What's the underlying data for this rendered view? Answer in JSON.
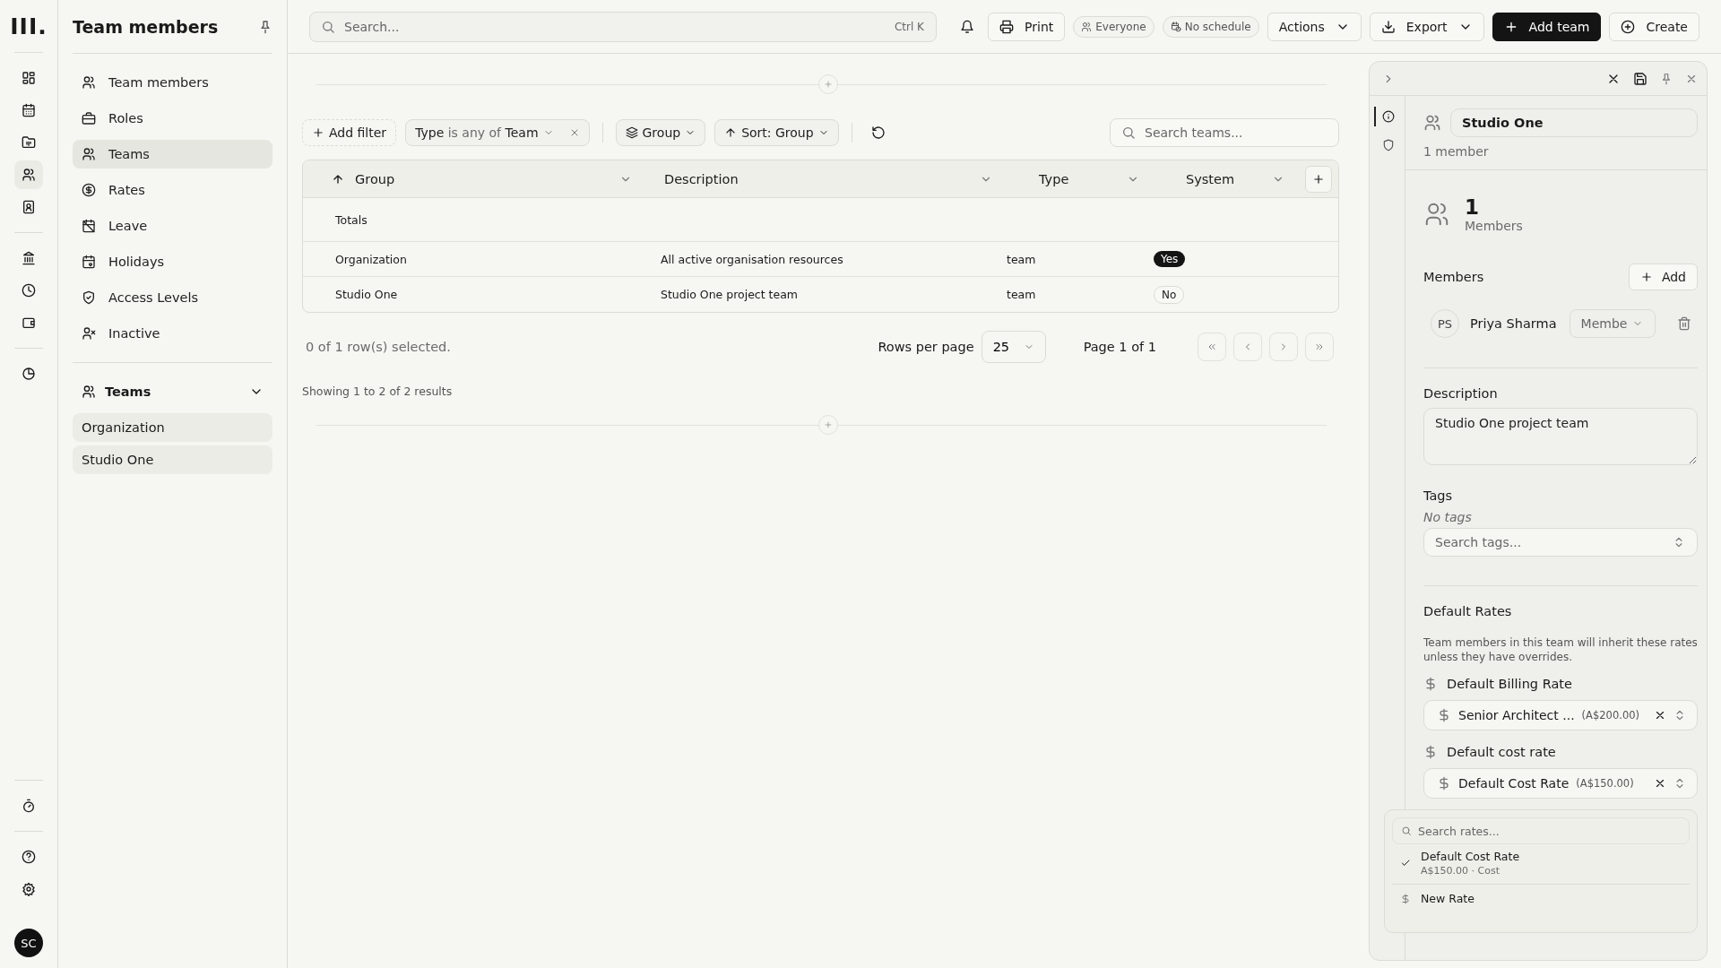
{
  "rail": {
    "logo": "III.",
    "groups": [
      [
        {
          "selected": false
        },
        {
          "selected": false
        },
        {
          "selected": false
        },
        {
          "selected": true
        },
        {
          "selected": false
        }
      ],
      [
        {
          "selected": false
        },
        {
          "selected": false
        },
        {
          "selected": false
        }
      ],
      [
        {
          "selected": false
        }
      ]
    ],
    "bottom_groups": [
      [
        {
          "selected": false
        }
      ],
      [
        {
          "selected": false
        },
        {
          "selected": false
        }
      ]
    ],
    "avatar": "SC"
  },
  "sidebar": {
    "title": "Team members",
    "items": [
      {
        "label": "Team members",
        "selected": false
      },
      {
        "label": "Roles",
        "selected": false
      },
      {
        "label": "Teams",
        "selected": true
      },
      {
        "label": "Rates",
        "selected": false
      },
      {
        "label": "Leave",
        "selected": false
      },
      {
        "label": "Holidays",
        "selected": false
      },
      {
        "label": "Access Levels",
        "selected": false
      },
      {
        "label": "Inactive",
        "selected": false
      }
    ],
    "section": {
      "title": "Teams",
      "expanded": true,
      "items": [
        {
          "label": "Organization"
        },
        {
          "label": "Studio One"
        }
      ]
    }
  },
  "topbar": {
    "search": {
      "placeholder": "Search...",
      "shortcut": "Ctrl K"
    },
    "buttons": [
      {
        "kind": "bell"
      },
      {
        "kind": "print",
        "label": "Print"
      },
      {
        "kind": "chip-users",
        "label": "Everyone"
      },
      {
        "kind": "chip-schedule",
        "label": "No schedule"
      },
      {
        "kind": "menu",
        "label": "Actions"
      },
      {
        "kind": "export",
        "label": "Export"
      },
      {
        "kind": "primary",
        "label": "Add team"
      },
      {
        "kind": "create",
        "label": "Create"
      }
    ]
  },
  "toolbar": {
    "add_filter": "Add filter",
    "filter": {
      "field": "Type",
      "operator": "is any of",
      "value": "Team"
    },
    "group": "Group",
    "sort": "Sort: Group",
    "search": {
      "placeholder": "Search teams..."
    }
  },
  "table": {
    "columns": [
      {
        "label": "Group",
        "sorted": true
      },
      {
        "label": "Description",
        "sorted": false
      },
      {
        "label": "Type",
        "sorted": false
      },
      {
        "label": "System",
        "sorted": false
      }
    ],
    "totals_label": "Totals",
    "rows": [
      {
        "group": "Organization",
        "description": "All active organisation resources",
        "type": "team",
        "system": {
          "label": "Yes",
          "kind": "yes"
        }
      },
      {
        "group": "Studio One",
        "description": "Studio One project team",
        "type": "team",
        "system": {
          "label": "No",
          "kind": "no"
        }
      }
    ]
  },
  "footer": {
    "selection": "0 of 1 row(s) selected.",
    "rows_per_page_label": "Rows per page",
    "rows_per_page": "25",
    "page": "Page 1 of 1",
    "results": "Showing 1 to 2 of 2 results"
  },
  "panel": {
    "name": "Studio One",
    "member_count": "1 member",
    "stat": {
      "value": "1",
      "label": "Members"
    },
    "members_heading": "Members",
    "add_label": "Add",
    "members": [
      {
        "initials": "PS",
        "name": "Priya Sharma",
        "role": "Membe"
      }
    ],
    "description_label": "Description",
    "description": "Studio One project team",
    "tags_label": "Tags",
    "no_tags": "No tags",
    "tags_placeholder": "Search tags...",
    "rates_heading": "Default Rates",
    "rates_note": "Team members in this team will inherit these rates unless they have overrides.",
    "rates": [
      {
        "label": "Default Billing Rate",
        "value": "Senior Architect ...",
        "amount": "(A$200.00)"
      },
      {
        "label": "Default cost rate",
        "value": "Default Cost Rate",
        "amount": "(A$150.00)"
      }
    ],
    "tabs": [
      {
        "selected": true
      },
      {
        "selected": false
      }
    ],
    "popover": {
      "placeholder": "Search rates...",
      "items": [
        {
          "kind": "option",
          "label": "Default Cost Rate",
          "detail": "A$150.00 · Cost",
          "checked": true
        },
        {
          "kind": "create",
          "label": "New Rate"
        }
      ]
    }
  }
}
